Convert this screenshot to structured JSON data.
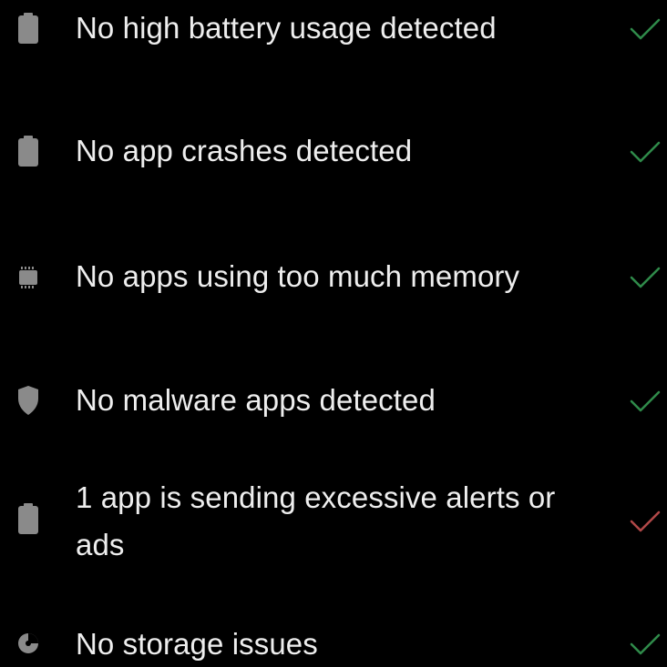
{
  "checks": [
    {
      "label": "No high battery usage detected",
      "icon": "battery-icon",
      "status": "ok"
    },
    {
      "label": "No app crashes detected",
      "icon": "battery-icon",
      "status": "ok"
    },
    {
      "label": "No apps using too much memory",
      "icon": "memory-chip-icon",
      "status": "ok"
    },
    {
      "label": "No malware apps detected",
      "icon": "shield-icon",
      "status": "ok"
    },
    {
      "label": "1 app is sending excessive alerts or ads",
      "icon": "battery-icon",
      "status": "warning"
    },
    {
      "label": "No storage issues",
      "icon": "pie-chart-icon",
      "status": "ok"
    }
  ],
  "colors": {
    "background": "#000000",
    "text": "#eeeeee",
    "icon": "#8a8a8a",
    "ok_check": "#2f8a4a",
    "warning_check": "#b04848"
  }
}
